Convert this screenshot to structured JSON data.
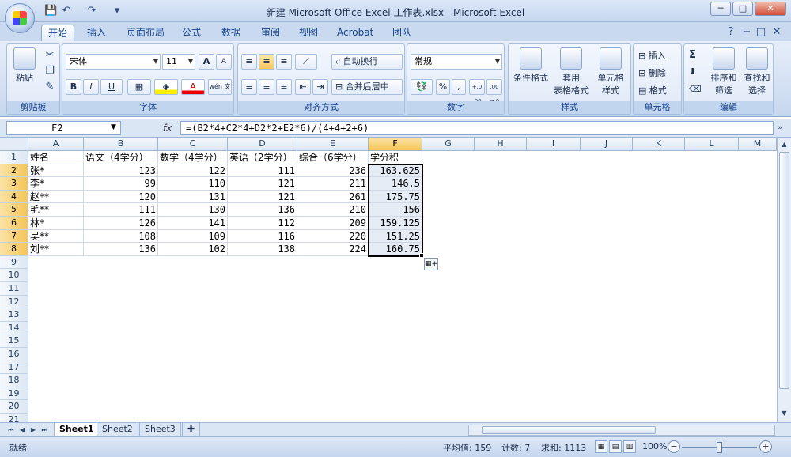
{
  "window": {
    "title": "新建 Microsoft Office Excel 工作表.xlsx - Microsoft Excel",
    "controls": [
      "─",
      "□",
      "✕"
    ]
  },
  "quick_access": {
    "save": "💾",
    "undo": "↶",
    "redo": "↷",
    "more": "▾"
  },
  "ribbon_tabs": [
    "开始",
    "插入",
    "页面布局",
    "公式",
    "数据",
    "审阅",
    "视图",
    "Acrobat",
    "团队"
  ],
  "active_tab": "开始",
  "ribbon_groups": {
    "clipboard": {
      "label": "剪贴板",
      "paste": "粘贴"
    },
    "font": {
      "label": "字体",
      "font_name": "宋体",
      "font_size": "11",
      "bold": "B",
      "italic": "I",
      "underline": "U",
      "grow": "A",
      "shrink": "A",
      "phonetic": "wén 文"
    },
    "alignment": {
      "label": "对齐方式",
      "wrap_text": "自动换行",
      "merge_center": "合并后居中"
    },
    "number": {
      "label": "数字",
      "format": "常规",
      "percent": "%",
      "comma": ",",
      "inc_decimal": "+.0 .00",
      "dec_decimal": ".00 →.0"
    },
    "styles": {
      "label": "样式",
      "conditional": "条件格式",
      "table_line1": "套用",
      "table_line2": "表格格式",
      "cell_line1": "单元格",
      "cell_line2": "样式"
    },
    "cells": {
      "label": "单元格",
      "insert": "插入",
      "delete": "删除",
      "format": "格式"
    },
    "editing": {
      "label": "编辑",
      "sum": "Σ",
      "sort_line1": "排序和",
      "sort_line2": "筛选",
      "find_line1": "查找和",
      "find_line2": "选择"
    }
  },
  "formula_bar": {
    "name_box": "F2",
    "fx": "fx",
    "formula": "=(B2*4+C2*4+D2*2+E2*6)/(4+4+2+6)"
  },
  "columns": [
    "A",
    "B",
    "C",
    "D",
    "E",
    "F",
    "G",
    "H",
    "I",
    "J",
    "K",
    "L",
    "M"
  ],
  "row_numbers": [
    "1",
    "2",
    "3",
    "4",
    "5",
    "6",
    "7",
    "8",
    "9",
    "10",
    "11",
    "12",
    "13",
    "14",
    "15",
    "16",
    "17",
    "18",
    "19",
    "20",
    "21"
  ],
  "sheet": {
    "headers": [
      "姓名",
      "语文（4学分）",
      "数学（4学分）",
      "英语（2学分）",
      "综合（6学分）",
      "学分积"
    ],
    "rows": [
      [
        "张*",
        "123",
        "122",
        "111",
        "236",
        "163.625"
      ],
      [
        "李*",
        "99",
        "110",
        "121",
        "211",
        "146.5"
      ],
      [
        "赵**",
        "120",
        "131",
        "121",
        "261",
        "175.75"
      ],
      [
        "毛**",
        "111",
        "130",
        "136",
        "210",
        "156"
      ],
      [
        "林*",
        "126",
        "141",
        "112",
        "209",
        "159.125"
      ],
      [
        "吴**",
        "108",
        "109",
        "116",
        "220",
        "151.25"
      ],
      [
        "刘**",
        "136",
        "102",
        "138",
        "224",
        "160.75"
      ]
    ]
  },
  "sheet_tabs": [
    "Sheet1",
    "Sheet2",
    "Sheet3"
  ],
  "active_sheet": "Sheet1",
  "status": {
    "ready": "就绪",
    "average": "平均值: 159",
    "count": "计数: 7",
    "sum": "求和: 1113",
    "zoom": "100%"
  },
  "colors": {
    "selection_header": "#f5c557",
    "ribbon": "#d0def2",
    "selection_fill": "#e6ecf6"
  }
}
